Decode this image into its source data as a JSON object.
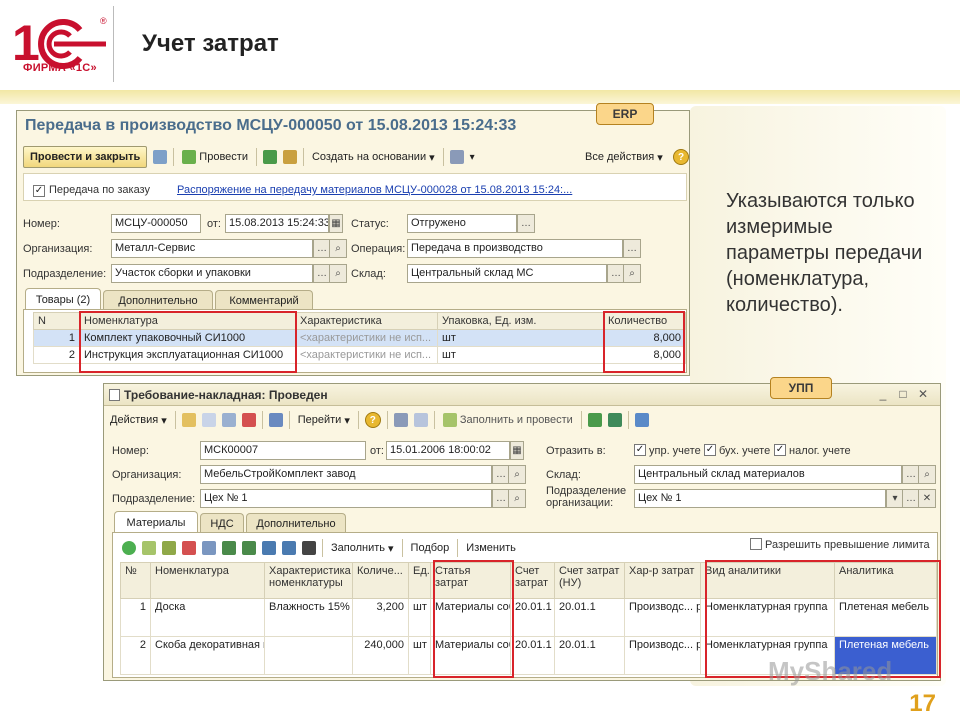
{
  "slide": {
    "logo_text": "ФИРМА «1С»",
    "title": "Учет затрат",
    "note": "Указываются только измеримые параметры передачи (номенклатура, количество).",
    "page_number": "17",
    "watermark": "MyShared"
  },
  "erp": {
    "badge": "ERP",
    "doc_title": "Передача в производство МСЦУ-000050 от 15.08.2013 15:24:33",
    "toolbar": {
      "post_close": "Провести и закрыть",
      "post": "Провести",
      "create_based": "Создать на основании",
      "all_actions": "Все действия",
      "help": "?"
    },
    "by_order_label": "Передача по заказу",
    "order_link": "Распоряжение на передачу материалов МСЦУ-000028 от 15.08.2013 15:24:...",
    "fields": {
      "number_label": "Номер:",
      "number": "МСЦУ-000050",
      "from_label": "от:",
      "date": "15.08.2013 15:24:33",
      "status_label": "Статус:",
      "status": "Отгружено",
      "org_label": "Организация:",
      "org": "Металл-Сервис",
      "operation_label": "Операция:",
      "operation": "Передача в производство",
      "dept_label": "Подразделение:",
      "dept": "Участок сборки и упаковки",
      "warehouse_label": "Склад:",
      "warehouse": "Центральный склад МС"
    },
    "tabs": [
      "Товары (2)",
      "Дополнительно",
      "Комментарий"
    ],
    "table": {
      "columns": [
        "N",
        "Номенклатура",
        "Характеристика",
        "Упаковка, Ед. изм.",
        "Количество"
      ],
      "rows": [
        [
          "1",
          "Комплект упаковочный СИ1000",
          "<характеристики не исп...",
          "шт",
          "8,000"
        ],
        [
          "2",
          "Инструкция эксплуатационная СИ1000",
          "<характеристики не исп...",
          "шт",
          "8,000"
        ]
      ]
    }
  },
  "upp": {
    "badge": "УПП",
    "window_title": "Требование-накладная: Проведен",
    "toolbar": {
      "actions": "Действия",
      "goto": "Перейти",
      "fill_post": "Заполнить и провести",
      "help": "?"
    },
    "fields": {
      "number_label": "Номер:",
      "number": "МСК00007",
      "from_label": "от:",
      "date": "15.01.2006 18:00:02",
      "reflect_label": "Отразить в:",
      "mgmt": "упр. учете",
      "acc": "бух. учете",
      "tax": "налог. учете",
      "org_label": "Организация:",
      "org": "МебельСтройКомплект завод",
      "warehouse_label": "Склад:",
      "warehouse": "Центральный склад материалов",
      "dept_label": "Подразделение:",
      "dept": "Цех № 1",
      "org_dept_label": "Подразделение организации:",
      "org_dept": "Цех № 1"
    },
    "tabs": [
      "Материалы",
      "НДС",
      "Дополнительно"
    ],
    "table_toolbar": {
      "fill": "Заполнить",
      "select": "Подбор",
      "edit": "Изменить",
      "allow_limit": "Разрешить превышение лимита"
    },
    "table": {
      "columns": [
        "№",
        "Номенклатура",
        "Характеристика номенклатуры",
        "Количе...",
        "Ед...",
        "Статья затрат",
        "Счет затрат",
        "Счет затрат (НУ)",
        "Хар-р затрат",
        "Вид аналитики",
        "Аналитика"
      ],
      "rows": [
        [
          "1",
          "Доска",
          "Влажность 15%",
          "3,200",
          "шт",
          "Материалы собственные",
          "20.01.1",
          "20.01.1",
          "Производс... расходы",
          "Номенклатурная группа",
          "Плетеная мебель"
        ],
        [
          "2",
          "Скоба декоративная мебельная",
          "",
          "240,000",
          "шт",
          "Материалы собственные",
          "20.01.1",
          "20.01.1",
          "Производс... расходы",
          "Номенклатурная группа",
          "Плетеная мебель"
        ]
      ]
    }
  },
  "colors": {
    "accent_red": "#d8242a",
    "title_blue": "#4a6d8c",
    "page_number": "#e0a01c"
  }
}
